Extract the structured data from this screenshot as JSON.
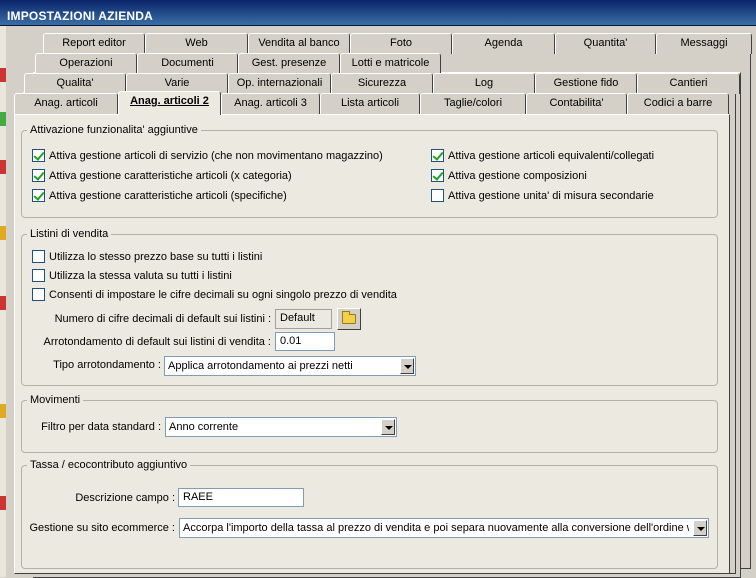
{
  "window": {
    "title": "IMPOSTAZIONI AZIENDA"
  },
  "tabs": {
    "row1": [
      "Report editor",
      "Web",
      "Vendita al banco",
      "Foto",
      "Agenda",
      "Quantita'",
      "Messaggi"
    ],
    "row2": [
      "Operazioni",
      "Documenti",
      "Gest. presenze",
      "Lotti e matricole"
    ],
    "row3": [
      "Qualita'",
      "Varie",
      "Op. internazionali",
      "Sicurezza",
      "Log",
      "Gestione fido",
      "Cantieri"
    ],
    "row4": [
      "Anag. articoli",
      "Anag. articoli 2",
      "Anag. articoli 3",
      "Lista articoli",
      "Taglie/colori",
      "Contabilita'",
      "Codici a barre"
    ],
    "active": "Anag. articoli 2"
  },
  "funzionalita": {
    "legend": "Attivazione funzionalita' aggiuntive",
    "left": [
      {
        "label": "Attiva gestione articoli di servizio (che non movimentano magazzino)",
        "checked": true
      },
      {
        "label": "Attiva gestione caratteristiche articoli (x categoria)",
        "checked": true
      },
      {
        "label": "Attiva gestione caratteristiche articoli (specifiche)",
        "checked": true
      }
    ],
    "right": [
      {
        "label": "Attiva gestione articoli equivalenti/collegati",
        "checked": true
      },
      {
        "label": "Attiva gestione composizioni",
        "checked": true
      },
      {
        "label": "Attiva gestione unita' di misura secondarie",
        "checked": false
      }
    ]
  },
  "listini": {
    "legend": "Listini di vendita",
    "checks": [
      {
        "label": "Utilizza lo stesso prezzo base su tutti i listini",
        "checked": false
      },
      {
        "label": "Utilizza la stessa valuta su tutti i listini",
        "checked": false
      },
      {
        "label": "Consenti di impostare le cifre decimali su ogni singolo prezzo di vendita",
        "checked": false
      }
    ],
    "decimali_label": "Numero di cifre decimali di default sui listini :",
    "decimali_value": "Default",
    "arrotondamento_label": "Arrotondamento di default sui listini di vendita :",
    "arrotondamento_value": "0.01",
    "tipo_label": "Tipo arrotondamento :",
    "tipo_value": "Applica arrotondamento ai prezzi netti"
  },
  "movimenti": {
    "legend": "Movimenti",
    "filtro_label": "Filtro per data standard :",
    "filtro_value": "Anno corrente"
  },
  "tassa": {
    "legend": "Tassa / ecocontributo aggiuntivo",
    "descrizione_label": "Descrizione campo :",
    "descrizione_value": "RAEE",
    "gestione_label": "Gestione su sito ecommerce :",
    "gestione_value": "Accorpa l'importo della tassa al prezzo di vendita e poi separa nuovamente alla conversione dell'ordine web"
  },
  "colors": {
    "titlebar": "#0a246a",
    "panel": "#ece9e1",
    "check": "#21a121"
  }
}
